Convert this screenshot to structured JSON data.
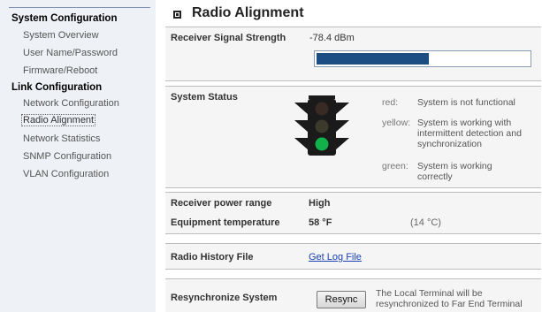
{
  "sidebar": {
    "groups": [
      {
        "heading": "System Configuration",
        "items": [
          "System Overview",
          "User Name/Password",
          "Firmware/Reboot"
        ]
      },
      {
        "heading": "Link Configuration",
        "items": [
          "Network Configuration",
          "Radio Alignment",
          "Network Statistics",
          "SNMP Configuration",
          "VLAN Configuration"
        ]
      }
    ],
    "active_item": "Radio Alignment"
  },
  "page": {
    "title": "Radio Alignment"
  },
  "signal": {
    "label": "Receiver Signal Strength",
    "value": "-78.4 dBm",
    "level_fraction": 0.53,
    "bar_color": "#1c4e84"
  },
  "status": {
    "label": "System Status",
    "active_light": "green",
    "lights_colors": {
      "red_off": "#3a2a25",
      "yellow_off": "#3b3a2c",
      "green_on": "#12b24a"
    },
    "legend": [
      {
        "key": "red:",
        "text": "System is not functional"
      },
      {
        "key": "yellow:",
        "text": "System is working with intermittent detection and synchronization"
      },
      {
        "key": "green:",
        "text": "System is working correctly"
      }
    ]
  },
  "power": {
    "range_label": "Receiver power range",
    "range_value": "High",
    "temp_label": "Equipment temperature",
    "temp_f": "58 °F",
    "temp_c": "(14 °C)"
  },
  "history": {
    "label": "Radio History File",
    "link_text": "Get Log File"
  },
  "resync": {
    "label": "Resynchronize System",
    "button": "Resync",
    "note": "The Local Terminal will be resynchronized to Far End Terminal"
  }
}
